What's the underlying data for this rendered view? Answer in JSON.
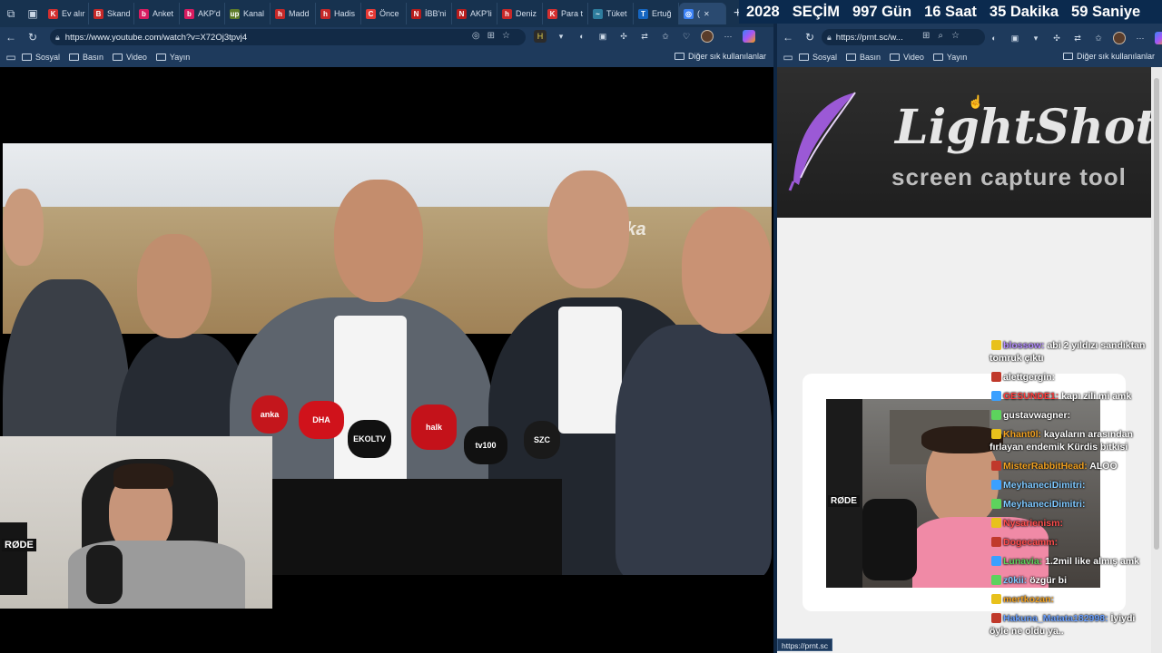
{
  "countdown": {
    "year": "2028",
    "label": "SEÇİM",
    "days": "997 Gün",
    "hours": "16 Saat",
    "minutes": "35 Dakika",
    "seconds": "59 Saniye"
  },
  "left_browser": {
    "tabs": [
      {
        "label": "Ev alır",
        "fav_color": "#d32f2f",
        "fav": "K"
      },
      {
        "label": "Skand",
        "fav_color": "#c62828",
        "fav": "B"
      },
      {
        "label": "Anket",
        "fav_color": "#d81b60",
        "fav": "b"
      },
      {
        "label": "AKP'd",
        "fav_color": "#d81b60",
        "fav": "b"
      },
      {
        "label": "Kanal",
        "fav_color": "#5e7d2a",
        "fav": "up"
      },
      {
        "label": "Madd",
        "fav_color": "#c62828",
        "fav": "h"
      },
      {
        "label": "Hadis",
        "fav_color": "#c62828",
        "fav": "h"
      },
      {
        "label": "Önce",
        "fav_color": "#e53935",
        "fav": "C"
      },
      {
        "label": "İBB'ni",
        "fav_color": "#b71c1c",
        "fav": "N"
      },
      {
        "label": "AKP'li",
        "fav_color": "#b71c1c",
        "fav": "N"
      },
      {
        "label": "Deniz",
        "fav_color": "#c62828",
        "fav": "h"
      },
      {
        "label": "Para t",
        "fav_color": "#d32f2f",
        "fav": "K"
      },
      {
        "label": "Tüket",
        "fav_color": "#2e7d9e",
        "fav": "~"
      },
      {
        "label": "Ertuğ",
        "fav_color": "#1565c0",
        "fav": "T"
      },
      {
        "label": "(",
        "fav_color": "#3b82f6",
        "fav": "◎"
      }
    ],
    "url": "https://www.youtube.com/watch?v=X72Oj3tpvj4",
    "bookmarks": [
      "Sosyal",
      "Basın",
      "Video",
      "Yayın"
    ],
    "other_bookmarks": "Diğer sık kullanılanlar",
    "video": {
      "watermark": "anka",
      "mics": [
        "anka",
        "DHA",
        "EKOLTV",
        "halk",
        "tv100",
        "SZC"
      ]
    },
    "webcam_brand": "RØDE"
  },
  "right_browser": {
    "url": "https://prnt.sc/w...",
    "bookmarks": [
      "Sosyal",
      "Basın",
      "Video",
      "Yayın"
    ],
    "other_bookmarks": "Diğer sık kullanılanlar",
    "lightshot": {
      "title": "LightShot",
      "subtitle": "screen capture tool"
    },
    "webcam_brand": "RØDE",
    "chat": [
      {
        "user": "blossow:",
        "user_color": "#b48cff",
        "text": "abi 2 yıldızı sandıktan tomruk çıktı"
      },
      {
        "user": "alettgergin:",
        "user_color": "#ffffff",
        "text": ""
      },
      {
        "user": "GESUNDE1:",
        "user_color": "#ff3b3b",
        "text": "kapı zili mi amk"
      },
      {
        "user": "gustavwagner:",
        "user_color": "#ffffff",
        "text": ""
      },
      {
        "user": "Khant0l:",
        "user_color": "#f0a020",
        "text": "kayaların arasından fırlayan endemik Kürdis bitkisi"
      },
      {
        "user": "MisterRabbitHead:",
        "user_color": "#f0a020",
        "text": "ALOO"
      },
      {
        "user": "MeyhaneciDimitri:",
        "user_color": "#7ec8ff",
        "text": ""
      },
      {
        "user": "MeyhaneciDimitri:",
        "user_color": "#7ec8ff",
        "text": ""
      },
      {
        "user": "Nysarienism:",
        "user_color": "#ff4d4d",
        "text": ""
      },
      {
        "user": "Dogecamm:",
        "user_color": "#ff4d4d",
        "text": ""
      },
      {
        "user": "Lunavia:",
        "user_color": "#5dd35d",
        "text": "1.2mil like almış amk"
      },
      {
        "user": "z0kii:",
        "user_color": "#7ec8ff",
        "text": "özgür bi"
      },
      {
        "user": "mertkozan:",
        "user_color": "#f0a020",
        "text": ""
      },
      {
        "user": "Hakuna_Matata182998:",
        "user_color": "#6aa0ff",
        "text": "İyiydi öyle ne oldu ya.."
      }
    ],
    "status_url": "https://prnt.sc"
  }
}
